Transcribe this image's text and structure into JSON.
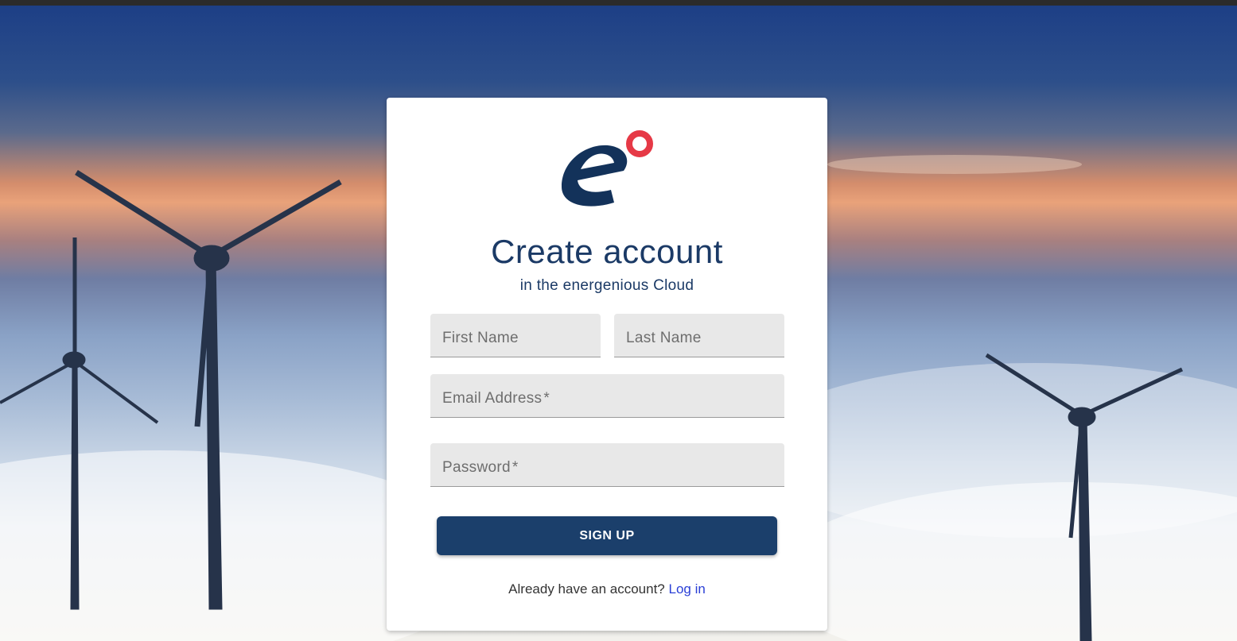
{
  "brand": {
    "logo_icon": "energenious-logo-icon",
    "logo_colors": {
      "letter": "#13325a",
      "circle": "#e63946"
    }
  },
  "header": {
    "title": "Create account",
    "subtitle": "in the energenious Cloud"
  },
  "form": {
    "first_name_placeholder": "First Name",
    "last_name_placeholder": "Last Name",
    "email_placeholder": "Email Address",
    "password_placeholder": "Password",
    "required_mark": "*",
    "signup_label": "SIGN UP"
  },
  "footer": {
    "prompt": "Already have an account?",
    "login_label": "Log in"
  },
  "colors": {
    "accent": "#1b3f6b",
    "link": "#2a3fd6",
    "title": "#1b3a66"
  }
}
